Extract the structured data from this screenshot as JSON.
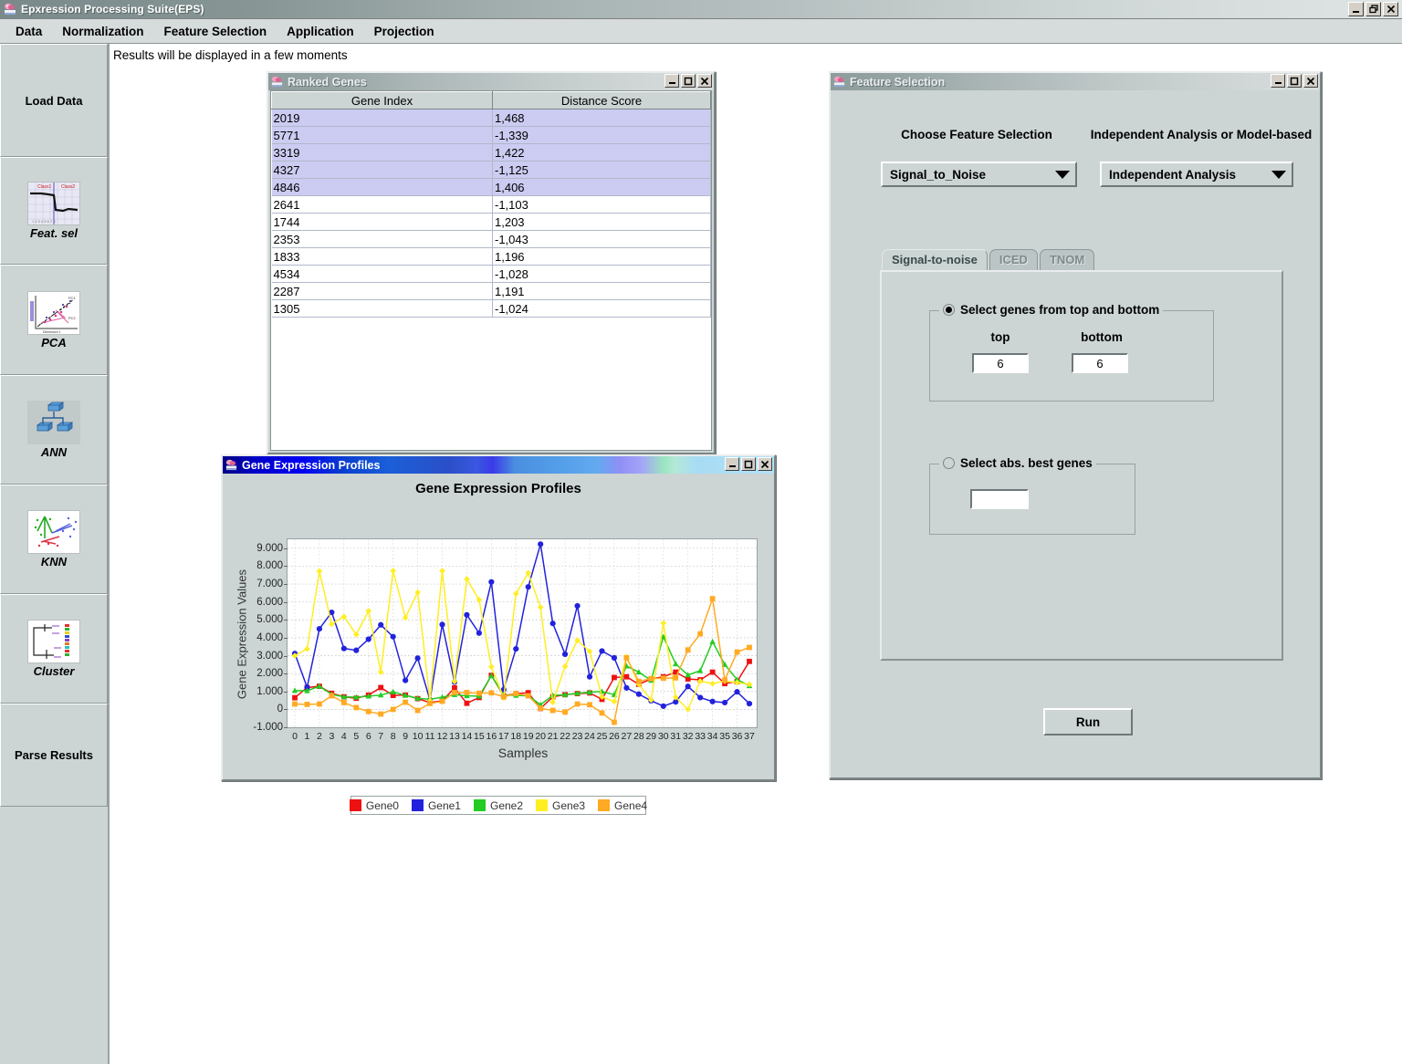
{
  "app": {
    "title": "Epxression Processing Suite(EPS)",
    "icon": "app-icon",
    "window_controls": {
      "minimize": "_",
      "restore": "restore",
      "close": "X"
    }
  },
  "menubar": {
    "items": [
      {
        "label": "Data"
      },
      {
        "label": "Normalization"
      },
      {
        "label": "Feature Selection"
      },
      {
        "label": "Application"
      },
      {
        "label": "Projection"
      }
    ]
  },
  "sidebar": {
    "items": [
      {
        "label": "Load Data",
        "icon": null,
        "caption": null
      },
      {
        "label": "Feat. sel",
        "icon": "feature-selection-plot-icon",
        "caption": "Feat. sel"
      },
      {
        "label": "PCA",
        "icon": "pca-scatter-icon",
        "caption": "PCA"
      },
      {
        "label": "ANN",
        "icon": "neural-network-icon",
        "caption": "ANN"
      },
      {
        "label": "KNN",
        "icon": "knn-scatter-icon",
        "caption": "KNN"
      },
      {
        "label": "Cluster",
        "icon": "dendrogram-icon",
        "caption": "Cluster"
      },
      {
        "label": "Parse Results",
        "icon": null,
        "caption": null
      }
    ]
  },
  "status": {
    "text": "Results will be displayed in a few moments"
  },
  "ranked_genes_window": {
    "title": "Ranked Genes",
    "columns": [
      "Gene Index",
      "Distance Score"
    ],
    "rows": [
      {
        "gene_index": "2019",
        "distance_score": "1,468",
        "selected": true
      },
      {
        "gene_index": "5771",
        "distance_score": "-1,339",
        "selected": true
      },
      {
        "gene_index": "3319",
        "distance_score": "1,422",
        "selected": true
      },
      {
        "gene_index": "4327",
        "distance_score": "-1,125",
        "selected": true
      },
      {
        "gene_index": "4846",
        "distance_score": "1,406",
        "selected": true
      },
      {
        "gene_index": "2641",
        "distance_score": "-1,103",
        "selected": false
      },
      {
        "gene_index": "1744",
        "distance_score": "1,203",
        "selected": false
      },
      {
        "gene_index": "2353",
        "distance_score": "-1,043",
        "selected": false
      },
      {
        "gene_index": "1833",
        "distance_score": "1,196",
        "selected": false
      },
      {
        "gene_index": "4534",
        "distance_score": "-1,028",
        "selected": false
      },
      {
        "gene_index": "2287",
        "distance_score": "1,191",
        "selected": false
      },
      {
        "gene_index": "1305",
        "distance_score": "-1,024",
        "selected": false
      }
    ]
  },
  "feature_selection_window": {
    "title": "Feature Selection",
    "choose_label": "Choose Feature Selection",
    "analysis_label": "Independent Analysis or Model-based",
    "method_combo": {
      "value": "Signal_to_Noise"
    },
    "analysis_combo": {
      "value": "Independent Analysis"
    },
    "tabs": [
      {
        "label": "Signal-to-noise",
        "active": true
      },
      {
        "label": "ICED",
        "active": false
      },
      {
        "label": "TNOM",
        "active": false
      }
    ],
    "top_bottom_group": {
      "legend": "Select genes from top and bottom",
      "selected": true,
      "top_label": "top",
      "bottom_label": "bottom",
      "top_value": "6",
      "bottom_value": "6"
    },
    "abs_best_group": {
      "legend": "Select abs. best genes",
      "selected": false,
      "value": ""
    },
    "run_button": "Run"
  },
  "chart_window": {
    "title": "Gene Expression Profiles"
  },
  "chart_data": {
    "type": "line",
    "title": "Gene Expression Profiles",
    "xlabel": "Samples",
    "ylabel": "Gene Expression Values",
    "ylim": [
      -1000,
      9500
    ],
    "yticks": [
      9000,
      8000,
      7000,
      6000,
      5000,
      4000,
      3000,
      2000,
      1000,
      0,
      -1000
    ],
    "ytick_labels": [
      "9.000",
      "8.000",
      "7.000",
      "6.000",
      "5.000",
      "4.000",
      "3.000",
      "2.000",
      "1.000",
      "0",
      "-1.000"
    ],
    "grid": true,
    "legend_position": "bottom",
    "x": [
      0,
      1,
      2,
      3,
      4,
      5,
      6,
      7,
      8,
      9,
      10,
      11,
      12,
      13,
      14,
      15,
      16,
      17,
      18,
      19,
      20,
      21,
      22,
      23,
      24,
      25,
      26,
      27,
      28,
      29,
      30,
      31,
      32,
      33,
      34,
      35,
      36,
      37
    ],
    "xtick_labels": [
      "0",
      "1",
      "2",
      "3",
      "4",
      "5",
      "6",
      "7",
      "8",
      "9",
      "10",
      "11",
      "12",
      "13",
      "14",
      "15",
      "16",
      "17",
      "18",
      "19",
      "20",
      "21",
      "22",
      "23",
      "24",
      "25",
      "26",
      "27",
      "28",
      "29",
      "30",
      "31",
      "32",
      "33",
      "34",
      "35",
      "36",
      "37"
    ],
    "series": [
      {
        "name": "Gene0",
        "color": "#ee1111",
        "marker": "square",
        "values": [
          650,
          1220,
          1290,
          900,
          700,
          620,
          800,
          1220,
          780,
          800,
          600,
          380,
          480,
          1200,
          340,
          660,
          1900,
          760,
          880,
          930,
          50,
          700,
          820,
          880,
          920,
          560,
          1780,
          1820,
          1400,
          1700,
          1820,
          2080,
          1700,
          1650,
          2080,
          1440,
          1550,
          2680
        ]
      },
      {
        "name": "Gene1",
        "color": "#2222dd",
        "marker": "circle",
        "values": [
          3120,
          1230,
          4500,
          5420,
          3400,
          3300,
          3920,
          4720,
          4060,
          1620,
          2860,
          520,
          4740,
          1520,
          5280,
          4260,
          7120,
          1100,
          3380,
          6840,
          9230,
          4800,
          3080,
          5780,
          1820,
          3260,
          2880,
          1200,
          850,
          480,
          180,
          420,
          1280,
          660,
          440,
          380,
          980,
          320
        ]
      },
      {
        "name": "Gene2",
        "color": "#22cc22",
        "marker": "triangle",
        "values": [
          1050,
          1040,
          1290,
          840,
          700,
          680,
          740,
          800,
          980,
          780,
          620,
          560,
          680,
          820,
          760,
          740,
          1880,
          800,
          780,
          760,
          260,
          780,
          820,
          900,
          960,
          1000,
          820,
          2420,
          2080,
          1620,
          4060,
          2540,
          1920,
          2160,
          3780,
          2500,
          1660,
          1320
        ]
      },
      {
        "name": "Gene3",
        "color": "#ffee22",
        "marker": "diamond",
        "values": [
          3000,
          3380,
          7720,
          4760,
          5180,
          4180,
          5500,
          2080,
          7740,
          5120,
          6540,
          480,
          7740,
          1560,
          7280,
          6120,
          2380,
          640,
          6460,
          7620,
          5700,
          400,
          2400,
          3860,
          3240,
          700,
          440,
          2940,
          1400,
          520,
          4820,
          680,
          0,
          1580,
          1440,
          1580,
          1500,
          1400
        ]
      },
      {
        "name": "Gene4",
        "color": "#ffaa22",
        "marker": "square",
        "values": [
          300,
          280,
          300,
          760,
          380,
          100,
          -120,
          -260,
          0,
          400,
          -60,
          330,
          450,
          940,
          940,
          900,
          920,
          700,
          880,
          760,
          60,
          -60,
          -150,
          300,
          260,
          -200,
          -720,
          2880,
          1560,
          1720,
          1740,
          1760,
          3320,
          4220,
          6180,
          1640,
          3200,
          3460
        ]
      }
    ]
  },
  "colors": {
    "desktop": "#ffffff",
    "panel": "#ccd4d4",
    "selection": "#ccccf2",
    "active_title": "#0000f2"
  }
}
